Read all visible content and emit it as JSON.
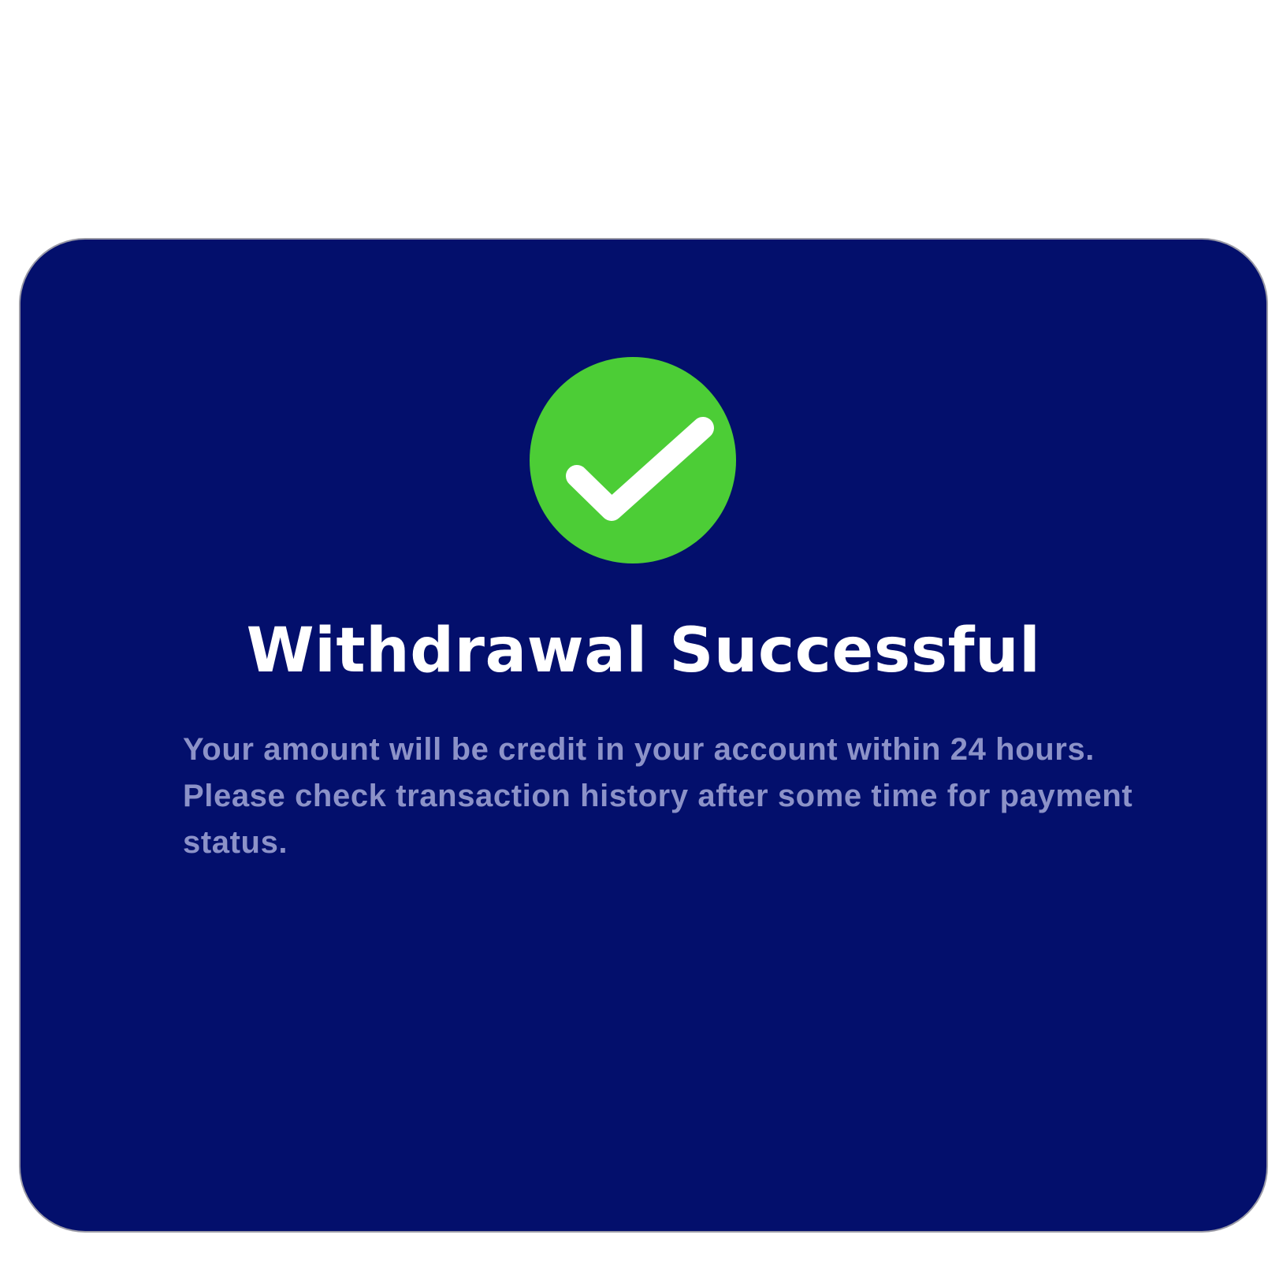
{
  "dialog": {
    "icon": "check-circle-icon",
    "title": "Withdrawal Successful",
    "message": "Your amount will be credit in your account within 24 hours. Please check transaction history after some time for payment status."
  },
  "colors": {
    "card_background": "#030f6c",
    "success_green": "#4ccd36",
    "title_text": "#ffffff",
    "message_text": "#8c92c8"
  }
}
